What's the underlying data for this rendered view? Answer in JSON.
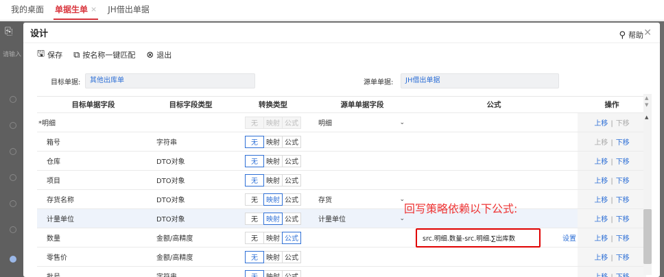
{
  "app_tabs": [
    {
      "label": "我的桌面",
      "active": false,
      "closable": false
    },
    {
      "label": "单据生单",
      "active": true,
      "closable": true
    },
    {
      "label": "JH借出单据",
      "active": false,
      "closable": false
    }
  ],
  "background": {
    "placeholder": "请输入"
  },
  "dialog": {
    "title": "设计",
    "close_icon": "close-icon",
    "toolbar": {
      "save": "保存",
      "match": "按名称一键匹配",
      "exit": "退出",
      "help": "帮助"
    },
    "target_label": "目标单据:",
    "target_value": "其他出库单",
    "source_label": "源单单据:",
    "source_value": "JH借出单据"
  },
  "table": {
    "headers": [
      "目标单据字段",
      "目标字段类型",
      "转换类型",
      "源单单据字段",
      "公式",
      "操作"
    ],
    "convert_options": [
      "无",
      "映射",
      "公式"
    ],
    "op_up": "上移",
    "op_sep": "|",
    "op_down": "下移",
    "rows": [
      {
        "field": "*明细",
        "type": "",
        "convert": "映射",
        "disabled": true,
        "source": "明细",
        "dropdown": true,
        "formula": "",
        "up_enabled": true,
        "down_enabled": false
      },
      {
        "field": "箱号",
        "type": "字符串",
        "convert": "无",
        "disabled": false,
        "source": "",
        "dropdown": false,
        "formula": "",
        "up_enabled": false,
        "down_enabled": true
      },
      {
        "field": "仓库",
        "type": "DTO对象",
        "convert": "无",
        "disabled": false,
        "source": "",
        "dropdown": false,
        "formula": "",
        "up_enabled": true,
        "down_enabled": true
      },
      {
        "field": "项目",
        "type": "DTO对象",
        "convert": "无",
        "disabled": false,
        "source": "",
        "dropdown": false,
        "formula": "",
        "up_enabled": true,
        "down_enabled": true
      },
      {
        "field": "存货名称",
        "type": "DTO对象",
        "convert": "映射",
        "disabled": false,
        "source": "存货",
        "dropdown": true,
        "formula": "",
        "up_enabled": true,
        "down_enabled": true
      },
      {
        "field": "计量单位",
        "type": "DTO对象",
        "convert": "映射",
        "disabled": false,
        "source": "计量单位",
        "dropdown": true,
        "formula": "",
        "up_enabled": true,
        "down_enabled": true,
        "highlight": true
      },
      {
        "field": "数量",
        "type": "金额/高精度",
        "convert": "公式",
        "disabled": false,
        "source": "",
        "dropdown": false,
        "formula": "src.明细.数量-src.明细.∑出库数",
        "formula_action": "设置",
        "up_enabled": true,
        "down_enabled": true
      },
      {
        "field": "零售价",
        "type": "金额/高精度",
        "convert": "无",
        "disabled": false,
        "source": "",
        "dropdown": false,
        "formula": "",
        "up_enabled": true,
        "down_enabled": true
      },
      {
        "field": "批号",
        "type": "字符串",
        "convert": "无",
        "disabled": false,
        "source": "",
        "dropdown": false,
        "formula": "",
        "up_enabled": true,
        "down_enabled": true
      }
    ]
  },
  "annotation": "回写策略依赖以下公式:",
  "colors": {
    "accent": "#2d6fd6",
    "active_tab": "#d9363e",
    "annotation": "#e33333",
    "highlight_box": "#e00000"
  }
}
